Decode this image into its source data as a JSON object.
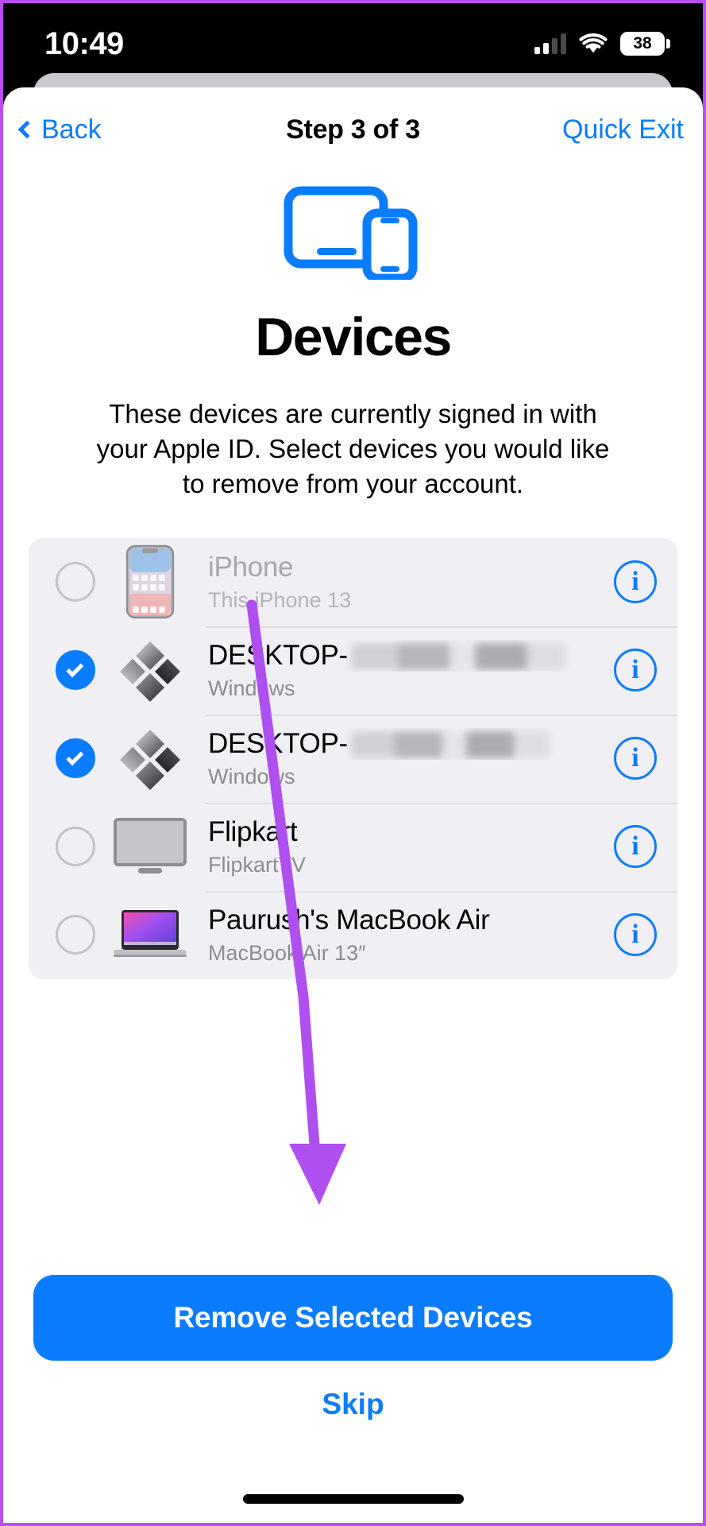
{
  "statusbar": {
    "time": "10:49",
    "battery_level": "38",
    "signal_icon": "cellular-signal-icon",
    "wifi_icon": "wifi-icon",
    "battery_icon": "battery-icon"
  },
  "navbar": {
    "back_label": "Back",
    "title": "Step 3 of 3",
    "quick_exit_label": "Quick Exit"
  },
  "hero": {
    "icon": "devices-icon",
    "title": "Devices",
    "description": "These devices are currently signed in with your Apple ID. Select devices you would like to remove from your account."
  },
  "devices": [
    {
      "name": "iPhone",
      "subtitle": "This iPhone 13",
      "checked": false,
      "dimmed": true,
      "thumb": "iphone-thumbnail",
      "censored": false,
      "info_label": "i"
    },
    {
      "name": "DESKTOP-",
      "subtitle": "Windows",
      "checked": true,
      "dimmed": false,
      "thumb": "windows-logo-thumbnail",
      "censored": true,
      "info_label": "i"
    },
    {
      "name": "DESKTOP-",
      "subtitle": "Windows",
      "checked": true,
      "dimmed": false,
      "thumb": "windows-logo-thumbnail",
      "censored": true,
      "info_label": "i"
    },
    {
      "name": "Flipkart",
      "subtitle": "FlipkartTV",
      "checked": false,
      "dimmed": false,
      "thumb": "tv-thumbnail",
      "censored": false,
      "info_label": "i"
    },
    {
      "name": "Paurush's MacBook Air",
      "subtitle": "MacBook Air 13″",
      "checked": false,
      "dimmed": false,
      "thumb": "macbook-thumbnail",
      "censored": false,
      "info_label": "i"
    }
  ],
  "footer": {
    "primary_label": "Remove Selected Devices",
    "skip_label": "Skip"
  },
  "colors": {
    "accent": "#0a7cff",
    "list_bg": "#efeff4",
    "annotation": "#b04ff0",
    "frame": "#b84ff0"
  },
  "annotation": {
    "arrow_icon": "purple-arrow-annotation"
  }
}
